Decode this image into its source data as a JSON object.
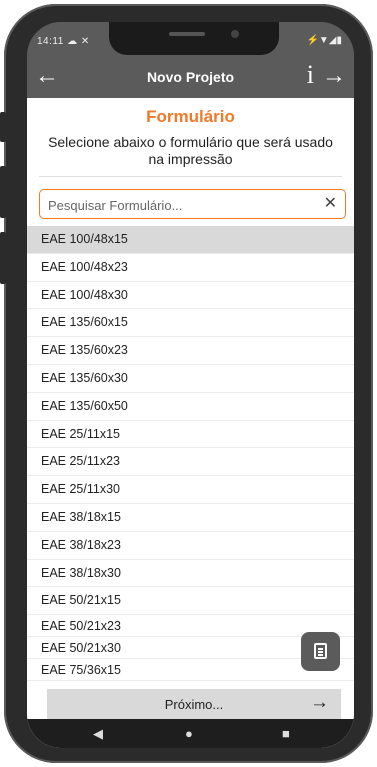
{
  "status": {
    "time": "14:11",
    "left_icons": "☁ ✕",
    "right_icons": "⚡▼◢▮"
  },
  "appbar": {
    "title": "Novo Projeto",
    "back_glyph": "←",
    "info_glyph": "i",
    "forward_glyph": "→"
  },
  "page": {
    "section_title": "Formulário",
    "subtitle": "Selecione abaixo o formulário que será usado na impressão"
  },
  "search": {
    "placeholder": "Pesquisar Formulário...",
    "value": "",
    "clear_glyph": "✕"
  },
  "forms": [
    "EAE 100/48x15",
    "EAE 100/48x23",
    "EAE 100/48x30",
    "EAE 135/60x15",
    "EAE 135/60x23",
    "EAE 135/60x30",
    "EAE 135/60x50",
    "EAE 25/11x15",
    "EAE 25/11x23",
    "EAE 25/11x30",
    "EAE 38/18x15",
    "EAE 38/18x23",
    "EAE 38/18x30",
    "EAE 50/21x15",
    "EAE 50/21x23",
    "EAE 50/21x30",
    "EAE 75/36x15"
  ],
  "selected_form": "EAE 100/48x15",
  "next_button": {
    "label": "Próximo...",
    "arrow": "→"
  },
  "navbar": {
    "back": "◀",
    "home": "●",
    "recents": "■"
  },
  "colors": {
    "accent": "#f07a2a",
    "appbar": "#5b5b5b",
    "selected_row": "#d9d9d9"
  }
}
